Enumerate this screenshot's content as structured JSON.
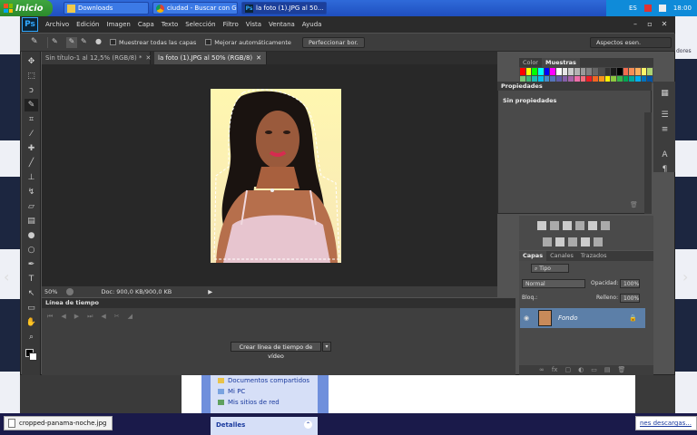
{
  "taskbar": {
    "start_label": "Inicio",
    "buttons": [
      {
        "label": "Downloads",
        "icon": "folder-icon"
      },
      {
        "label": "ciudad - Buscar con G...",
        "icon": "chrome-icon"
      },
      {
        "label": "la foto (1).JPG al 50...",
        "icon": "photoshop-icon"
      }
    ],
    "tray": {
      "lang": "ES",
      "time": "18:00"
    }
  },
  "photoshop": {
    "logo": "Ps",
    "menu": [
      "Archivo",
      "Edición",
      "Imagen",
      "Capa",
      "Texto",
      "Selección",
      "Filtro",
      "Vista",
      "Ventana",
      "Ayuda"
    ],
    "options": {
      "sample_all_layers": "Muestrear todas las capas",
      "auto_enhance": "Mejorar automáticamente",
      "refine_edge": "Perfeccionar bor.",
      "workspace": "Aspectos esen."
    },
    "tabs": [
      {
        "label": "Sin título-1 al 12,5% (RGB/8) *"
      },
      {
        "label": "la foto (1).JPG al 50% (RGB/8)"
      }
    ],
    "status": {
      "zoom": "50%",
      "doc": "Doc: 900,0 KB/900,0 KB"
    },
    "timeline": {
      "title": "Línea de tiempo",
      "create_button": "Crear línea de tiempo de vídeo"
    },
    "color_panel": {
      "tabs": [
        "Color",
        "Muestras"
      ]
    },
    "properties": {
      "title": "Propiedades",
      "content": "Sin propiedades"
    },
    "layers": {
      "tabs": [
        "Capas",
        "Canales",
        "Trazados"
      ],
      "filter": "Tipo",
      "blend_mode": "Normal",
      "opacity_label": "Opacidad:",
      "opacity_value": "100%",
      "lock_label": "Bloq.:",
      "fill_label": "Relleno:",
      "fill_value": "100%",
      "layer_name": "Fondo"
    }
  },
  "background": {
    "explorer_links": [
      "Documentos compartidos",
      "Mi PC",
      "Mis sitios de red"
    ],
    "details": "Detalles",
    "download_chip": "cropped-panama-noche.jpg",
    "right_text": "nes descargas...",
    "edge_text": "dores"
  }
}
